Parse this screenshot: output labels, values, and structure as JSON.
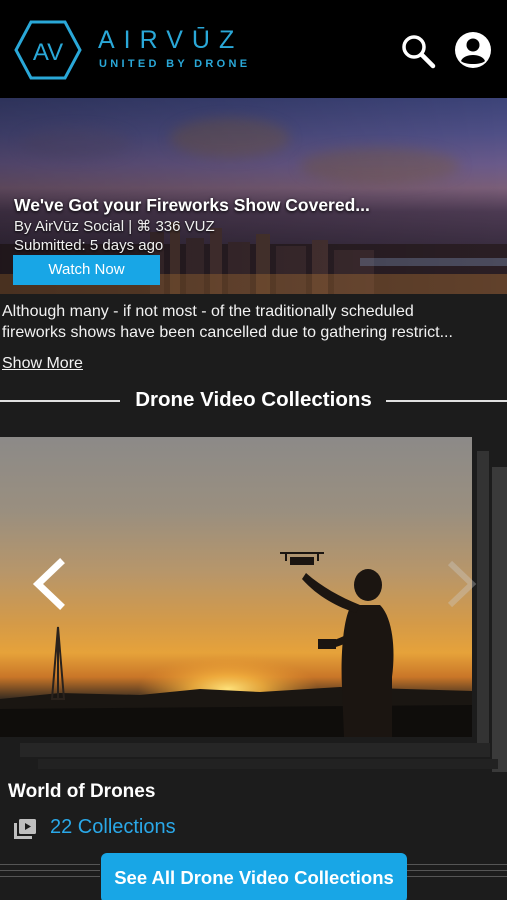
{
  "header": {
    "brand": "AIRVŪZ",
    "tagline": "UNITED BY DRONE",
    "logo_mark": "AV",
    "icons": [
      "airvuz-logo-icon",
      "search-icon",
      "account-icon"
    ],
    "accent_color": "#2aa8d8"
  },
  "hero": {
    "title": "We've Got your Fireworks Show Covered...",
    "meta": "By AirVūz Social | ⌘ 336 VUZ",
    "submitted": "Submitted: 5 days ago",
    "watch_label": "Watch Now"
  },
  "description": {
    "line1": "Although many - if not most - of the traditionally scheduled",
    "line2": "fireworks shows have been cancelled due to gathering restrict...",
    "show_more": "Show More"
  },
  "collections_section": {
    "title": "Drone Video Collections",
    "current": {
      "name": "World of Drones",
      "count_label": "22 Collections"
    },
    "see_all_label": "See All Drone Video Collections",
    "button_color": "#18a6e6"
  }
}
